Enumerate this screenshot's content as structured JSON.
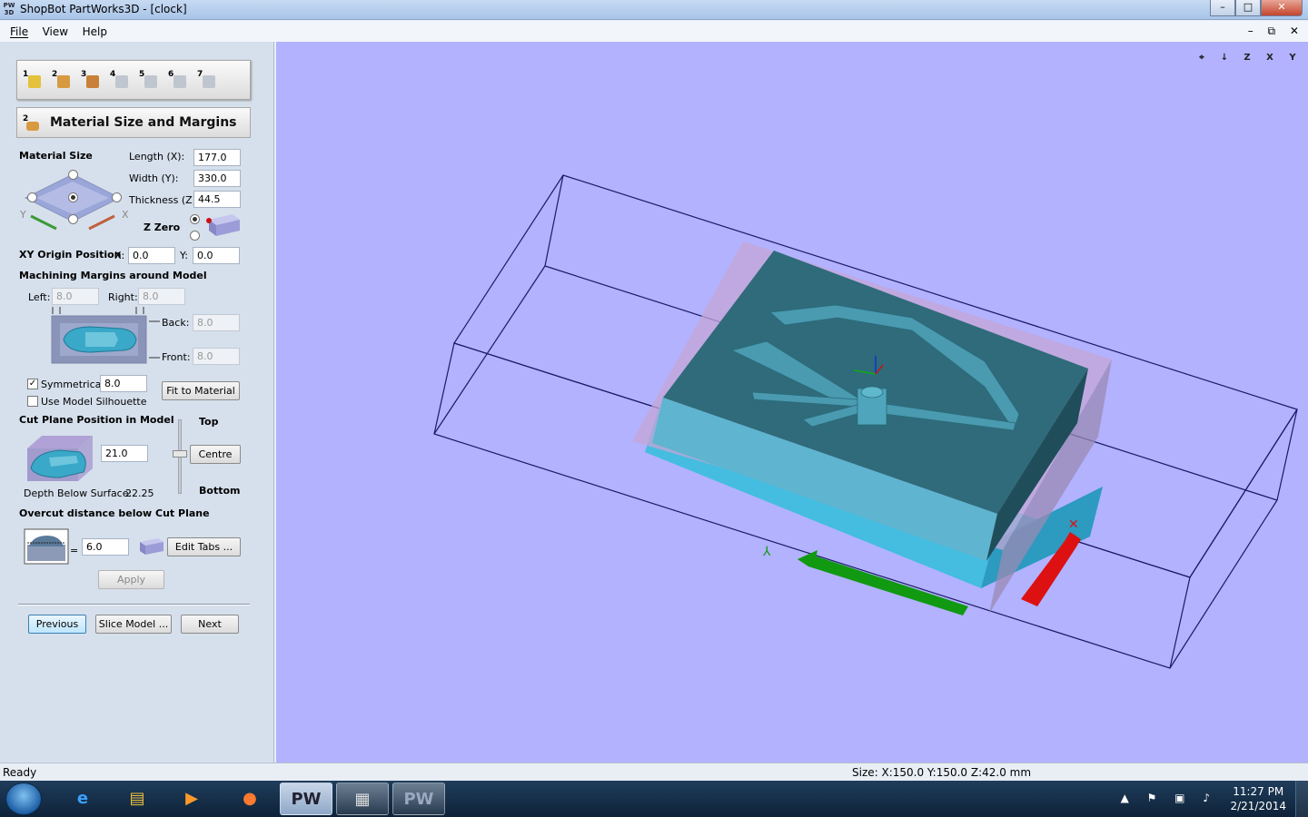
{
  "window": {
    "app_icon_text": "PW 3D",
    "title": "ShopBot PartWorks3D - [clock]",
    "minimize": "–",
    "maximize": "□",
    "close": "✕"
  },
  "menu": {
    "items": [
      "File",
      "View",
      "Help"
    ],
    "mdi_controls": "– ⧉ ✕"
  },
  "steps": [
    {
      "n": "1",
      "color": "#e5c23c"
    },
    {
      "n": "2",
      "color": "#d89a40"
    },
    {
      "n": "3",
      "color": "#c9813a"
    },
    {
      "n": "4",
      "color": "#c0c6d0"
    },
    {
      "n": "5",
      "color": "#c0c6d0"
    },
    {
      "n": "6",
      "color": "#c0c6d0"
    },
    {
      "n": "7",
      "color": "#c0c6d0"
    }
  ],
  "section": {
    "step_number": "2",
    "title": "Material Size and Margins"
  },
  "material_size": {
    "heading": "Material Size",
    "length_label": "Length (X):",
    "length_value": "177.0",
    "width_label": "Width (Y):",
    "width_value": "330.0",
    "thickness_label": "Thickness (Z):",
    "thickness_value": "44.5",
    "axis_y": "Y",
    "axis_x": "X",
    "z_zero_label": "Z Zero"
  },
  "xy_origin": {
    "label": "XY Origin Position",
    "x_label": "X:",
    "x_value": "0.0",
    "y_label": "Y:",
    "y_value": "0.0"
  },
  "margins": {
    "heading": "Machining Margins around Model",
    "left_label": "Left:",
    "left_value": "8.0",
    "right_label": "Right:",
    "right_value": "8.0",
    "back_label": "Back:",
    "back_value": "8.0",
    "front_label": "Front:",
    "front_value": "8.0",
    "symmetrical_label": "Symmetrical",
    "symmetrical_checked": "✓",
    "symmetrical_value": "8.0",
    "silhouette_label": "Use Model Silhouette",
    "fit_button": "Fit to Material"
  },
  "cut_plane": {
    "heading": "Cut Plane Position in Model",
    "value": "21.0",
    "top_label": "Top",
    "bottom_label": "Bottom",
    "centre_button": "Centre",
    "depth_label": "Depth Below Surface:",
    "depth_value": "22.25"
  },
  "overcut": {
    "heading": "Overcut distance below Cut Plane",
    "equals": "=",
    "value": "6.0",
    "edit_tabs_button": "Edit Tabs ...",
    "apply_button": "Apply"
  },
  "nav": {
    "previous": "Previous",
    "slice": "Slice Model ...",
    "next": "Next"
  },
  "view_tools": [
    "⌖",
    "↓",
    "Z",
    "X",
    "Y"
  ],
  "colors": {
    "viewport_bg": "#b2b2ff",
    "model_top": "#2f6b7a",
    "model_side": "#5fb4d0",
    "block": "#44bde0",
    "x_arrow": "#dd1111",
    "y_arrow": "#119911"
  },
  "status": {
    "left": "Ready",
    "right": "Size: X:150.0 Y:150.0 Z:42.0 mm"
  },
  "taskbar": {
    "items": [
      "e",
      "▤",
      "▶",
      "●",
      "PW",
      "▦",
      "PW"
    ],
    "tray_icons": "▲ ⚑ ▣ ♪",
    "time": "11:27 PM",
    "date": "2/21/2014"
  }
}
